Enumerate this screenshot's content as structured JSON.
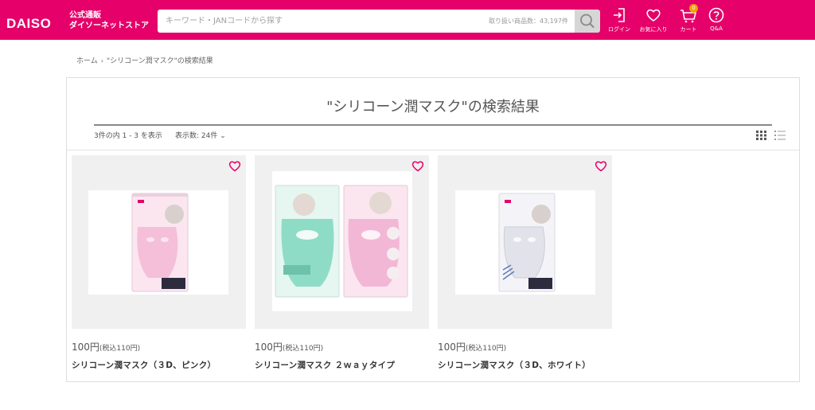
{
  "header": {
    "logo": "DAISO",
    "logo_sub_line1": "公式通販",
    "logo_sub_line2": "ダイソーネットストア",
    "search_placeholder": "キーワード・JANコードから探す",
    "search_count": "取り扱い商品数：43,197件",
    "nav": [
      {
        "label": "ログイン",
        "icon": "login-icon"
      },
      {
        "label": "お気に入り",
        "icon": "heart-icon"
      },
      {
        "label": "カート",
        "icon": "cart-icon",
        "badge": "0"
      },
      {
        "label": "Q&A",
        "icon": "help-icon"
      }
    ]
  },
  "breadcrumb": {
    "home": "ホーム",
    "separator": "›",
    "current": "\"シリコーン潤マスク\"の検索結果"
  },
  "results": {
    "title": "\"シリコーン潤マスク\"の検索結果",
    "count_text": "3件の内 1 - 3 を表示",
    "per_page": "表示数: 24件",
    "per_page_chevron": "⌄"
  },
  "products": [
    {
      "price": "100円",
      "tax": "(税込110円)",
      "name": "シリコーン潤マスク（３D、ピンク）",
      "mask_color": "#f3b7d6"
    },
    {
      "price": "100円",
      "tax": "(税込110円)",
      "name": "シリコーン潤マスク ２ｗａｙタイプ",
      "mask_color": "#8fdcc6"
    },
    {
      "price": "100円",
      "tax": "(税込110円)",
      "name": "シリコーン潤マスク（３D、ホワイト）",
      "mask_color": "#e9e9ee"
    }
  ],
  "colors": {
    "brand": "#e5006a",
    "fav_heart": "#e5006a"
  }
}
